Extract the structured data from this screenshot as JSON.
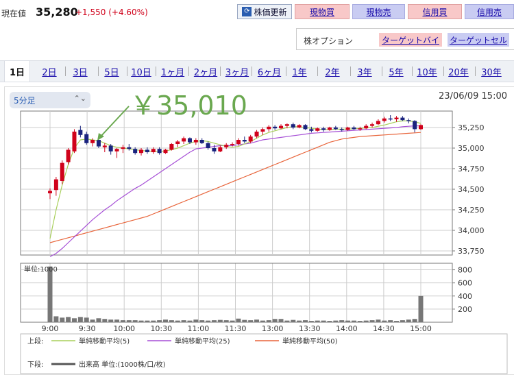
{
  "header": {
    "price_label": "現在値",
    "price": "35,280",
    "change": "+1,550 (+4.60%)",
    "refresh_label": "株価更新",
    "buttons": [
      "現物買",
      "現物売",
      "信用買",
      "信用売"
    ]
  },
  "options": {
    "label": "株オプション",
    "target_buy": "ターゲットバイ",
    "target_sell": "ターゲットセル"
  },
  "tabs": [
    "1日",
    "2日",
    "3日",
    "5日",
    "10日",
    "1ヶ月",
    "2ヶ月",
    "3ヶ月",
    "6ヶ月",
    "1年",
    "2年",
    "3年",
    "5年",
    "10年",
    "20年",
    "30年"
  ],
  "active_tab": 0,
  "interval": "5分足",
  "datetime": "23/06/09 15:00",
  "annotation": "￥35,010",
  "colors": {
    "up": "#d0021b",
    "down": "#1a237e",
    "ma5": "#a8cf5a",
    "ma25": "#a64fd6",
    "ma50": "#e8643a",
    "volume": "#777777",
    "annotation": "#6aa84f"
  },
  "legend": {
    "upper_label": "上段:",
    "lower_label": "下段:",
    "ma5": "単純移動平均(5)",
    "ma25": "単純移動平均(25)",
    "ma50": "単純移動平均(50)",
    "volume": "出来高 単位:(1000株/口/枚)"
  },
  "chart_data": [
    {
      "type": "candlestick",
      "title": "",
      "x_ticks": [
        "9:00",
        "9:30",
        "10:00",
        "10:30",
        "11:00",
        "11:30",
        "13:00",
        "13:30",
        "14:00",
        "14:30",
        "15:00"
      ],
      "y_ticks": [
        "33,750",
        "34,000",
        "34,250",
        "34,500",
        "34,750",
        "35,000",
        "35,250"
      ],
      "ylim": [
        33700,
        35450
      ],
      "grid": true,
      "candles": [
        {
          "t": "9:00",
          "o": 34450,
          "h": 34510,
          "l": 34380,
          "c": 34480
        },
        {
          "t": "9:05",
          "o": 34490,
          "h": 34650,
          "l": 34420,
          "c": 34620
        },
        {
          "t": "9:10",
          "o": 34600,
          "h": 34850,
          "l": 34560,
          "c": 34820
        },
        {
          "t": "9:15",
          "o": 34830,
          "h": 35000,
          "l": 34800,
          "c": 34980
        },
        {
          "t": "9:20",
          "o": 34960,
          "h": 35230,
          "l": 34940,
          "c": 35200
        },
        {
          "t": "9:25",
          "o": 35220,
          "h": 35270,
          "l": 35130,
          "c": 35160
        },
        {
          "t": "9:30",
          "o": 35170,
          "h": 35200,
          "l": 35040,
          "c": 35060
        },
        {
          "t": "9:35",
          "o": 35060,
          "h": 35120,
          "l": 35020,
          "c": 35100
        },
        {
          "t": "9:40",
          "o": 35100,
          "h": 35130,
          "l": 35000,
          "c": 35020
        },
        {
          "t": "9:45",
          "o": 35010,
          "h": 35060,
          "l": 34950,
          "c": 35030
        },
        {
          "t": "9:50",
          "o": 35030,
          "h": 35050,
          "l": 34920,
          "c": 34960
        },
        {
          "t": "9:55",
          "o": 34960,
          "h": 35000,
          "l": 34880,
          "c": 34990
        },
        {
          "t": "10:00",
          "o": 34990,
          "h": 35040,
          "l": 34940,
          "c": 35010
        },
        {
          "t": "10:05",
          "o": 35010,
          "h": 35050,
          "l": 34970,
          "c": 34990
        },
        {
          "t": "10:10",
          "o": 34990,
          "h": 35010,
          "l": 34920,
          "c": 34940
        },
        {
          "t": "10:15",
          "o": 34940,
          "h": 35000,
          "l": 34910,
          "c": 34980
        },
        {
          "t": "10:20",
          "o": 34980,
          "h": 35010,
          "l": 34930,
          "c": 34950
        },
        {
          "t": "10:25",
          "o": 34950,
          "h": 35010,
          "l": 34930,
          "c": 34990
        },
        {
          "t": "10:30",
          "o": 34990,
          "h": 35010,
          "l": 34920,
          "c": 34940
        },
        {
          "t": "10:35",
          "o": 34940,
          "h": 34990,
          "l": 34930,
          "c": 34980
        },
        {
          "t": "10:40",
          "o": 34980,
          "h": 35060,
          "l": 34970,
          "c": 35050
        },
        {
          "t": "10:45",
          "o": 35050,
          "h": 35100,
          "l": 35010,
          "c": 35080
        },
        {
          "t": "10:50",
          "o": 35080,
          "h": 35140,
          "l": 35050,
          "c": 35120
        },
        {
          "t": "10:55",
          "o": 35120,
          "h": 35130,
          "l": 35050,
          "c": 35070
        },
        {
          "t": "11:00",
          "o": 35070,
          "h": 35120,
          "l": 35040,
          "c": 35100
        },
        {
          "t": "11:05",
          "o": 35100,
          "h": 35120,
          "l": 35050,
          "c": 35060
        },
        {
          "t": "11:10",
          "o": 35060,
          "h": 35080,
          "l": 34980,
          "c": 35000
        },
        {
          "t": "11:15",
          "o": 35000,
          "h": 35040,
          "l": 34930,
          "c": 34960
        },
        {
          "t": "11:20",
          "o": 34960,
          "h": 35030,
          "l": 34950,
          "c": 35010
        },
        {
          "t": "11:25",
          "o": 35010,
          "h": 35060,
          "l": 34990,
          "c": 35040
        },
        {
          "t": "11:30",
          "o": 35040,
          "h": 35070,
          "l": 35020,
          "c": 35050
        },
        {
          "t": "12:30",
          "o": 35050,
          "h": 35120,
          "l": 35030,
          "c": 35100
        },
        {
          "t": "12:35",
          "o": 35100,
          "h": 35140,
          "l": 35060,
          "c": 35080
        },
        {
          "t": "12:40",
          "o": 35080,
          "h": 35160,
          "l": 35060,
          "c": 35140
        },
        {
          "t": "12:45",
          "o": 35140,
          "h": 35220,
          "l": 35120,
          "c": 35200
        },
        {
          "t": "12:50",
          "o": 35200,
          "h": 35250,
          "l": 35160,
          "c": 35230
        },
        {
          "t": "12:55",
          "o": 35230,
          "h": 35280,
          "l": 35200,
          "c": 35260
        },
        {
          "t": "13:00",
          "o": 35260,
          "h": 35280,
          "l": 35220,
          "c": 35240
        },
        {
          "t": "13:05",
          "o": 35240,
          "h": 35290,
          "l": 35230,
          "c": 35270
        },
        {
          "t": "13:10",
          "o": 35270,
          "h": 35300,
          "l": 35240,
          "c": 35290
        },
        {
          "t": "13:15",
          "o": 35290,
          "h": 35310,
          "l": 35230,
          "c": 35250
        },
        {
          "t": "13:20",
          "o": 35250,
          "h": 35290,
          "l": 35240,
          "c": 35280
        },
        {
          "t": "13:25",
          "o": 35280,
          "h": 35290,
          "l": 35220,
          "c": 35230
        },
        {
          "t": "13:30",
          "o": 35230,
          "h": 35260,
          "l": 35190,
          "c": 35210
        },
        {
          "t": "13:35",
          "o": 35210,
          "h": 35250,
          "l": 35200,
          "c": 35240
        },
        {
          "t": "13:40",
          "o": 35240,
          "h": 35260,
          "l": 35200,
          "c": 35220
        },
        {
          "t": "13:45",
          "o": 35220,
          "h": 35260,
          "l": 35210,
          "c": 35250
        },
        {
          "t": "13:50",
          "o": 35250,
          "h": 35270,
          "l": 35220,
          "c": 35230
        },
        {
          "t": "13:55",
          "o": 35230,
          "h": 35250,
          "l": 35200,
          "c": 35220
        },
        {
          "t": "14:00",
          "o": 35220,
          "h": 35260,
          "l": 35210,
          "c": 35250
        },
        {
          "t": "14:05",
          "o": 35250,
          "h": 35270,
          "l": 35220,
          "c": 35230
        },
        {
          "t": "14:10",
          "o": 35230,
          "h": 35260,
          "l": 35210,
          "c": 35240
        },
        {
          "t": "14:15",
          "o": 35240,
          "h": 35290,
          "l": 35230,
          "c": 35270
        },
        {
          "t": "14:20",
          "o": 35270,
          "h": 35310,
          "l": 35250,
          "c": 35290
        },
        {
          "t": "14:25",
          "o": 35290,
          "h": 35350,
          "l": 35280,
          "c": 35330
        },
        {
          "t": "14:30",
          "o": 35330,
          "h": 35380,
          "l": 35310,
          "c": 35360
        },
        {
          "t": "14:35",
          "o": 35360,
          "h": 35400,
          "l": 35330,
          "c": 35350
        },
        {
          "t": "14:40",
          "o": 35350,
          "h": 35390,
          "l": 35320,
          "c": 35370
        },
        {
          "t": "14:45",
          "o": 35370,
          "h": 35390,
          "l": 35330,
          "c": 35340
        },
        {
          "t": "14:50",
          "o": 35340,
          "h": 35360,
          "l": 35300,
          "c": 35330
        },
        {
          "t": "14:55",
          "o": 35330,
          "h": 35340,
          "l": 35190,
          "c": 35230
        },
        {
          "t": "15:00",
          "o": 35230,
          "h": 35290,
          "l": 35220,
          "c": 35280
        }
      ],
      "ma5": [
        33900,
        34250,
        34550,
        34800,
        35000,
        35100,
        35110,
        35100,
        35090,
        35060,
        35030,
        35010,
        35000,
        34990,
        34980,
        34970,
        34965,
        34960,
        34960,
        34965,
        34980,
        35000,
        35030,
        35060,
        35080,
        35090,
        35080,
        35060,
        35040,
        35020,
        35010,
        35020,
        35050,
        35080,
        35120,
        35160,
        35190,
        35210,
        35230,
        35250,
        35260,
        35260,
        35250,
        35240,
        35230,
        35225,
        35225,
        35230,
        35230,
        35230,
        35235,
        35240,
        35245,
        35250,
        35265,
        35280,
        35300,
        35320,
        35330,
        35330,
        35320,
        35300
      ],
      "ma25": [
        33680,
        33720,
        33780,
        33850,
        33920,
        33990,
        34060,
        34130,
        34190,
        34250,
        34300,
        34360,
        34410,
        34460,
        34510,
        34550,
        34600,
        34650,
        34700,
        34750,
        34800,
        34850,
        34900,
        34950,
        34990,
        35000,
        35010,
        35020,
        35030,
        35030,
        35030,
        35040,
        35050,
        35060,
        35080,
        35100,
        35110,
        35120,
        35130,
        35140,
        35150,
        35160,
        35170,
        35180,
        35185,
        35190,
        35195,
        35200,
        35205,
        35210,
        35215,
        35220,
        35225,
        35230,
        35235,
        35240,
        35245,
        35250,
        35260,
        35265,
        35270,
        35270
      ],
      "ma50": [
        33850,
        33870,
        33890,
        33910,
        33930,
        33950,
        33970,
        33990,
        34010,
        34030,
        34050,
        34070,
        34090,
        34110,
        34130,
        34150,
        34170,
        34200,
        34230,
        34260,
        34290,
        34320,
        34350,
        34380,
        34410,
        34440,
        34470,
        34500,
        34530,
        34560,
        34590,
        34620,
        34650,
        34680,
        34710,
        34740,
        34770,
        34800,
        34830,
        34860,
        34890,
        34920,
        34950,
        34980,
        35010,
        35040,
        35070,
        35090,
        35110,
        35120,
        35130,
        35140,
        35145,
        35150,
        35155,
        35160,
        35165,
        35170,
        35175,
        35180,
        35185,
        35190
      ]
    },
    {
      "type": "bar",
      "title": "",
      "unit_label": "単位:1000",
      "y_ticks": [
        "200",
        "400",
        "600",
        "800"
      ],
      "ylim": [
        0,
        900
      ],
      "values": [
        850,
        90,
        70,
        80,
        60,
        80,
        70,
        40,
        60,
        50,
        40,
        40,
        30,
        30,
        30,
        25,
        25,
        25,
        30,
        40,
        30,
        25,
        30,
        25,
        40,
        30,
        25,
        30,
        35,
        30,
        25,
        55,
        35,
        30,
        40,
        25,
        30,
        50,
        50,
        25,
        35,
        25,
        30,
        20,
        25,
        25,
        20,
        25,
        30,
        25,
        25,
        20,
        25,
        30,
        40,
        25,
        30,
        20,
        30,
        40,
        50,
        400
      ]
    }
  ]
}
